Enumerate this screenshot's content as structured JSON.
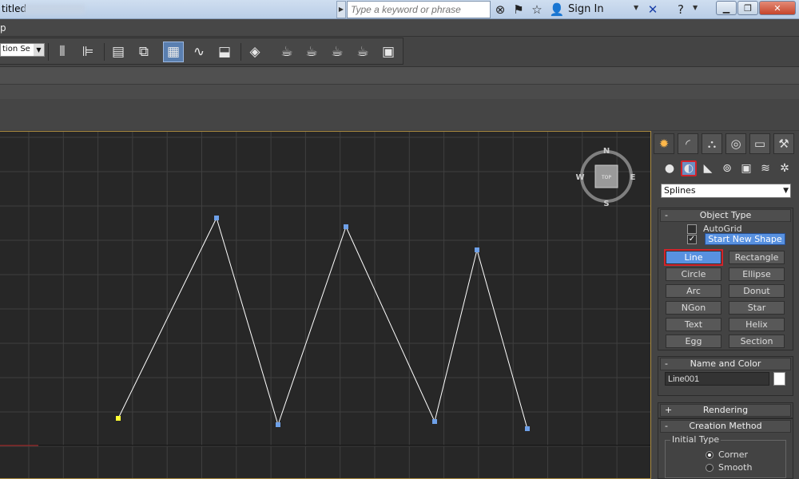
{
  "window": {
    "title": "titled",
    "search_placeholder": "Type a keyword or phrase",
    "sign_in": "Sign In"
  },
  "menu": {
    "visible_label": "p"
  },
  "toolbar": {
    "selection_set": "tion Se"
  },
  "command_panel": {
    "tabs": [
      "create",
      "modify",
      "hierarchy",
      "motion",
      "display",
      "utilities"
    ],
    "categories": [
      "geometry",
      "shapes",
      "lights",
      "cameras",
      "helpers",
      "space-warps",
      "systems"
    ],
    "selected_category": "shapes",
    "subtype": "Splines",
    "object_type": {
      "title": "Object Type",
      "autogrid": "AutoGrid",
      "autogrid_checked": false,
      "start_new_shape": "Start New Shape",
      "start_new_shape_checked": true,
      "buttons": [
        [
          "Line",
          "Rectangle"
        ],
        [
          "Circle",
          "Ellipse"
        ],
        [
          "Arc",
          "Donut"
        ],
        [
          "NGon",
          "Star"
        ],
        [
          "Text",
          "Helix"
        ],
        [
          "Egg",
          "Section"
        ]
      ],
      "active_button": "Line"
    },
    "name_and_color": {
      "title": "Name and Color",
      "name": "Line001",
      "color": "#ffffff"
    },
    "rendering": {
      "title": "Rendering",
      "collapsed": true
    },
    "creation_method": {
      "title": "Creation Method",
      "group": "Initial Type",
      "options": [
        "Corner",
        "Smooth"
      ],
      "selected": "Corner"
    }
  },
  "viewport": {
    "view": "TOP",
    "viewcube_labels": {
      "n": "N",
      "s": "S",
      "e": "E",
      "w": "W"
    },
    "line_color": "#ffffff",
    "vertex_color": "#6ea0e8",
    "first_vertex_color": "#ffff33",
    "grid_color": "#3f3f3f",
    "border_color": "#aa8b40"
  }
}
